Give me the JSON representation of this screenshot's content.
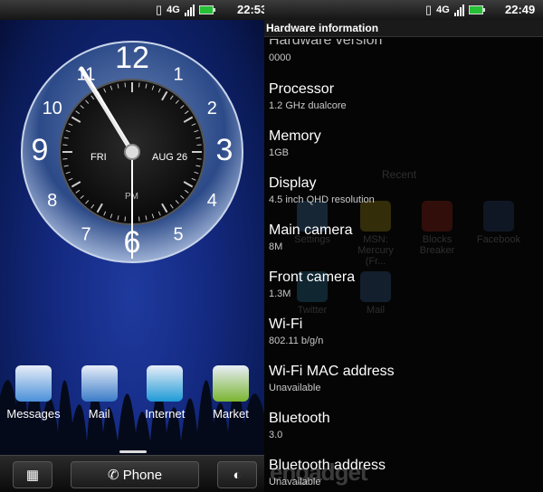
{
  "left": {
    "status": {
      "time": "22:53",
      "net": "4G"
    },
    "clock": {
      "day": "FRI",
      "date": "AUG 26",
      "ampm": "PM",
      "numerals": [
        "12",
        "1",
        "2",
        "3",
        "4",
        "5",
        "6",
        "7",
        "8",
        "9",
        "10",
        "11"
      ]
    },
    "apps": [
      {
        "label": "Messages",
        "icon": "messages-icon",
        "color": "#4a90d9"
      },
      {
        "label": "Mail",
        "icon": "mail-icon",
        "color": "#3a7bc8"
      },
      {
        "label": "Internet",
        "icon": "globe-icon",
        "color": "#1e9ad6"
      },
      {
        "label": "Market",
        "icon": "market-icon",
        "color": "#7ab531"
      }
    ],
    "dock": {
      "phone_label": "Phone"
    },
    "watermark": "engadget"
  },
  "right": {
    "status": {
      "time": "22:49",
      "net": "4G"
    },
    "title": "Hardware information",
    "cut_item": "Hardware version",
    "cut_value": "0000",
    "items": [
      {
        "title": "Processor",
        "value": "1.2 GHz dualcore"
      },
      {
        "title": "Memory",
        "value": "1GB"
      },
      {
        "title": "Display",
        "value": "4.5 inch QHD resolution"
      },
      {
        "title": "Main camera",
        "value": "8M"
      },
      {
        "title": "Front camera",
        "value": "1.3M"
      },
      {
        "title": "Wi-Fi",
        "value": "802.11 b/g/n"
      },
      {
        "title": "Wi-Fi MAC address",
        "value": "Unavailable"
      },
      {
        "title": "Bluetooth",
        "value": "3.0"
      },
      {
        "title": "Bluetooth address",
        "value": "Unavailable"
      }
    ],
    "ghost": {
      "recent": "Recent",
      "apps": [
        {
          "label": "Settings",
          "icon": "settings-icon"
        },
        {
          "label": "MSN: Mercury (Fr...",
          "icon": "msn-icon"
        },
        {
          "label": "Blocks Breaker",
          "icon": "blocks-icon"
        },
        {
          "label": "Facebook",
          "icon": "facebook-icon"
        },
        {
          "label": "Twitter",
          "icon": "twitter-icon"
        },
        {
          "label": "Mail",
          "icon": "mail-icon"
        }
      ]
    },
    "watermark": "engadget"
  }
}
